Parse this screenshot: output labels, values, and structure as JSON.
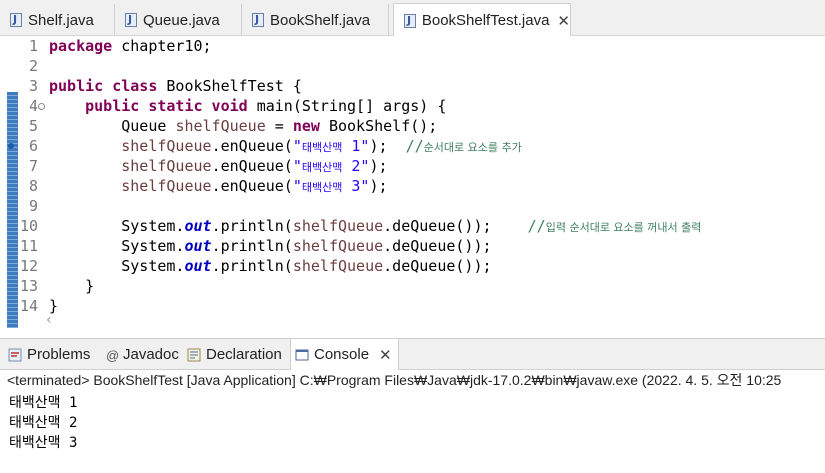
{
  "editor_tabs": [
    {
      "label": "Shelf.java",
      "active": false
    },
    {
      "label": "Queue.java",
      "active": false
    },
    {
      "label": "BookShelf.java",
      "active": false
    },
    {
      "label": "BookShelfTest.java",
      "active": true
    }
  ],
  "code_lines": [
    {
      "n": "1",
      "tokens": [
        {
          "t": "package",
          "c": "kw"
        },
        {
          "t": " chapter10;",
          "c": ""
        }
      ]
    },
    {
      "n": "2",
      "tokens": []
    },
    {
      "n": "3",
      "tokens": [
        {
          "t": "public class",
          "c": "kw"
        },
        {
          "t": " BookShelfTest {",
          "c": ""
        }
      ]
    },
    {
      "n": "4",
      "fold": true,
      "tokens": [
        {
          "t": "    ",
          "c": ""
        },
        {
          "t": "public static void",
          "c": "kw"
        },
        {
          "t": " main(String[] args) {",
          "c": ""
        }
      ]
    },
    {
      "n": "5",
      "tokens": [
        {
          "t": "        Queue ",
          "c": ""
        },
        {
          "t": "shelfQueue",
          "c": "var"
        },
        {
          "t": " = ",
          "c": ""
        },
        {
          "t": "new",
          "c": "kw"
        },
        {
          "t": " BookShelf();",
          "c": ""
        }
      ]
    },
    {
      "n": "6",
      "bp": true,
      "tokens": [
        {
          "t": "        ",
          "c": ""
        },
        {
          "t": "shelfQueue",
          "c": "var"
        },
        {
          "t": ".enQueue(",
          "c": ""
        },
        {
          "t": "\"",
          "c": "str"
        },
        {
          "t": "태백산맥",
          "c": "str ko"
        },
        {
          "t": " 1\"",
          "c": "str"
        },
        {
          "t": ");  ",
          "c": ""
        },
        {
          "t": "//",
          "c": "cmt"
        },
        {
          "t": "순서대로 요소를 추가",
          "c": "cmt ko"
        }
      ]
    },
    {
      "n": "7",
      "tokens": [
        {
          "t": "        ",
          "c": ""
        },
        {
          "t": "shelfQueue",
          "c": "var"
        },
        {
          "t": ".enQueue(",
          "c": ""
        },
        {
          "t": "\"",
          "c": "str"
        },
        {
          "t": "태백산맥",
          "c": "str ko"
        },
        {
          "t": " 2\"",
          "c": "str"
        },
        {
          "t": ");",
          "c": ""
        }
      ]
    },
    {
      "n": "8",
      "tokens": [
        {
          "t": "        ",
          "c": ""
        },
        {
          "t": "shelfQueue",
          "c": "var"
        },
        {
          "t": ".enQueue(",
          "c": ""
        },
        {
          "t": "\"",
          "c": "str"
        },
        {
          "t": "태백산맥",
          "c": "str ko"
        },
        {
          "t": " 3\"",
          "c": "str"
        },
        {
          "t": ");",
          "c": ""
        }
      ]
    },
    {
      "n": "9",
      "tokens": []
    },
    {
      "n": "10",
      "tokens": [
        {
          "t": "        System.",
          "c": ""
        },
        {
          "t": "out",
          "c": "fld"
        },
        {
          "t": ".println(",
          "c": ""
        },
        {
          "t": "shelfQueue",
          "c": "var"
        },
        {
          "t": ".deQueue());    ",
          "c": ""
        },
        {
          "t": "//",
          "c": "cmt"
        },
        {
          "t": "입력 순서대로 요소를 꺼내서 출력",
          "c": "cmt ko"
        }
      ]
    },
    {
      "n": "11",
      "tokens": [
        {
          "t": "        System.",
          "c": ""
        },
        {
          "t": "out",
          "c": "fld"
        },
        {
          "t": ".println(",
          "c": ""
        },
        {
          "t": "shelfQueue",
          "c": "var"
        },
        {
          "t": ".deQueue());",
          "c": ""
        }
      ]
    },
    {
      "n": "12",
      "tokens": [
        {
          "t": "        System.",
          "c": ""
        },
        {
          "t": "out",
          "c": "fld"
        },
        {
          "t": ".println(",
          "c": ""
        },
        {
          "t": "shelfQueue",
          "c": "var"
        },
        {
          "t": ".deQueue());",
          "c": ""
        }
      ]
    },
    {
      "n": "13",
      "tokens": [
        {
          "t": "    }",
          "c": ""
        }
      ]
    },
    {
      "n": "14",
      "tokens": [
        {
          "t": "}",
          "c": ""
        }
      ]
    }
  ],
  "panel_tabs": {
    "problems": "Problems",
    "javadoc": "Javadoc",
    "declaration": "Declaration",
    "console": "Console"
  },
  "console": {
    "status": "<terminated> BookShelfTest [Java Application] C:₩Program Files₩Java₩jdk-17.0.2₩bin₩javaw.exe  (2022. 4. 5. 오전 10:25",
    "output": [
      "태백산맥 1",
      "태백산맥 2",
      "태백산맥 3"
    ]
  },
  "colors": {
    "keyword": "#7f0055",
    "string": "#2a00ff",
    "comment": "#3f7f5f",
    "field": "#0000c0",
    "local_var": "#6a3e3e",
    "ruler": "#3e7bbf"
  }
}
